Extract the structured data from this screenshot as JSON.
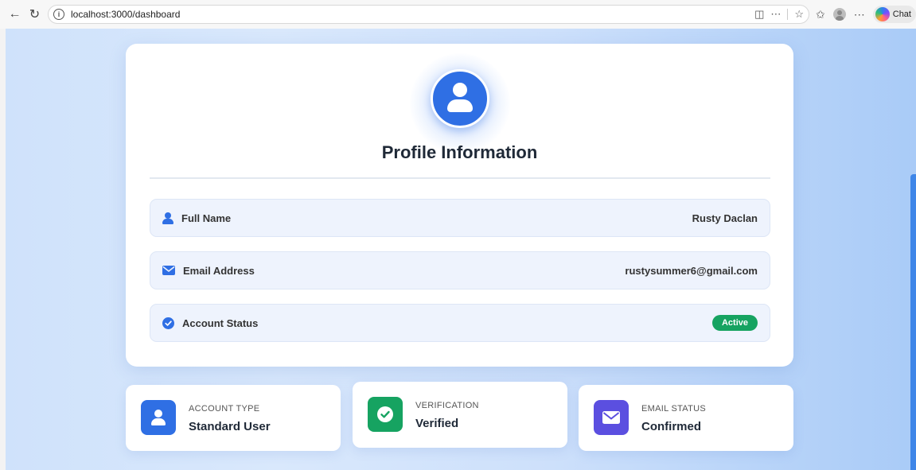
{
  "browser": {
    "url": "localhost:3000/dashboard",
    "chat_label": "Chat"
  },
  "profile": {
    "title": "Profile Information",
    "fields": [
      {
        "label": "Full Name",
        "value": "Rusty Daclan"
      },
      {
        "label": "Email Address",
        "value": "rustysummer6@gmail.com"
      },
      {
        "label": "Account Status",
        "value": "Active"
      }
    ]
  },
  "stats": [
    {
      "label": "ACCOUNT TYPE",
      "value": "Standard User"
    },
    {
      "label": "VERIFICATION",
      "value": "Verified"
    },
    {
      "label": "EMAIL STATUS",
      "value": "Confirmed"
    }
  ],
  "colors": {
    "primary": "#2f6fe4",
    "success": "#16a361",
    "purple": "#5b4fe0",
    "row_bg": "#eef3fd"
  }
}
